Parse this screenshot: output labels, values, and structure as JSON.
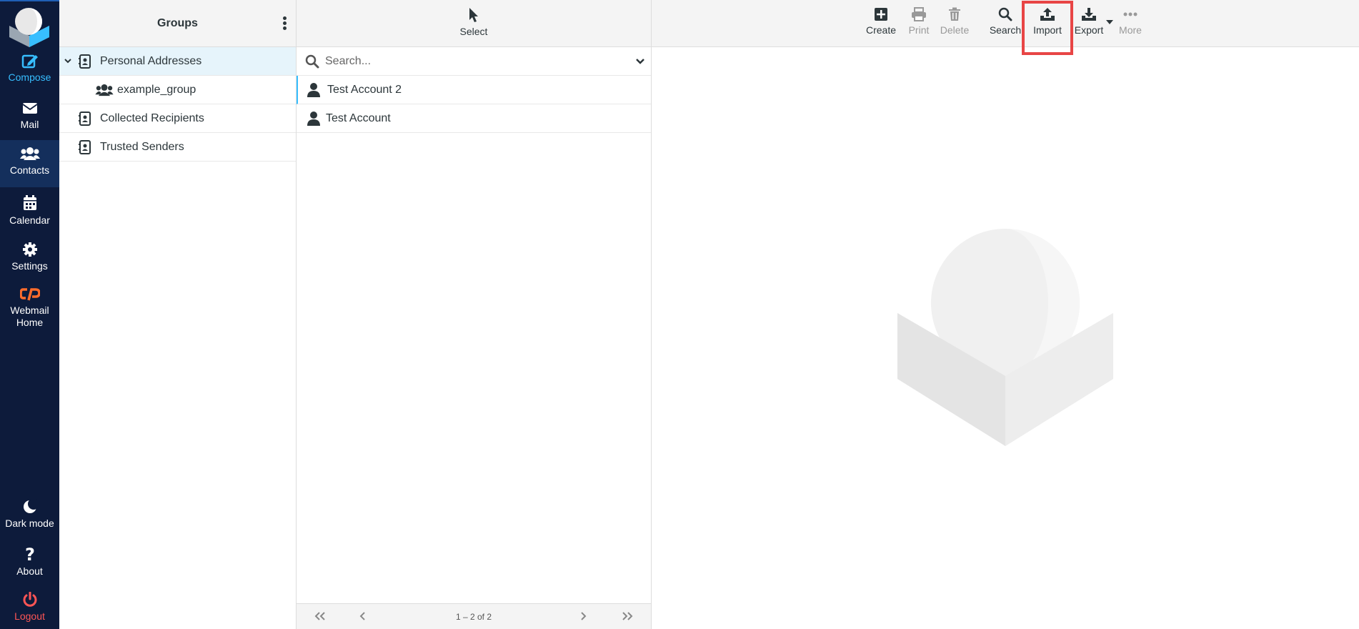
{
  "nav": {
    "items": [
      {
        "label": "Compose",
        "icon": "compose-icon"
      },
      {
        "label": "Mail",
        "icon": "envelope-icon"
      },
      {
        "label": "Contacts",
        "icon": "users-icon"
      },
      {
        "label": "Calendar",
        "icon": "calendar-icon"
      },
      {
        "label": "Settings",
        "icon": "gear-icon"
      },
      {
        "label_line1": "Webmail",
        "label_line2": "Home",
        "icon": "cpanel-icon"
      }
    ],
    "bottom": [
      {
        "label": "Dark mode",
        "icon": "moon-icon"
      },
      {
        "label": "About",
        "icon": "question-icon"
      },
      {
        "label": "Logout",
        "icon": "power-icon"
      }
    ]
  },
  "groups": {
    "title": "Groups",
    "items": [
      {
        "label": "Personal Addresses",
        "icon": "address-book-icon",
        "selected": true,
        "expanded": true
      },
      {
        "label": "example_group",
        "icon": "group-icon",
        "child": true
      },
      {
        "label": "Collected Recipients",
        "icon": "address-book-icon"
      },
      {
        "label": "Trusted Senders",
        "icon": "address-book-icon"
      }
    ]
  },
  "contacts": {
    "select_label": "Select",
    "search_placeholder": "Search...",
    "items": [
      {
        "label": "Test Account 2",
        "icon": "user-icon"
      },
      {
        "label": "Test Account",
        "icon": "user-icon"
      }
    ],
    "pager_info": "1 – 2 of 2"
  },
  "toolbar": {
    "create": "Create",
    "print": "Print",
    "delete": "Delete",
    "search": "Search",
    "import": "Import",
    "export": "Export",
    "more": "More"
  },
  "colors": {
    "nav_bg": "#0d1b3b",
    "accent": "#37beff",
    "logout": "#ff5555",
    "highlight": "#e84545",
    "cpanel": "#ff6c2c"
  }
}
